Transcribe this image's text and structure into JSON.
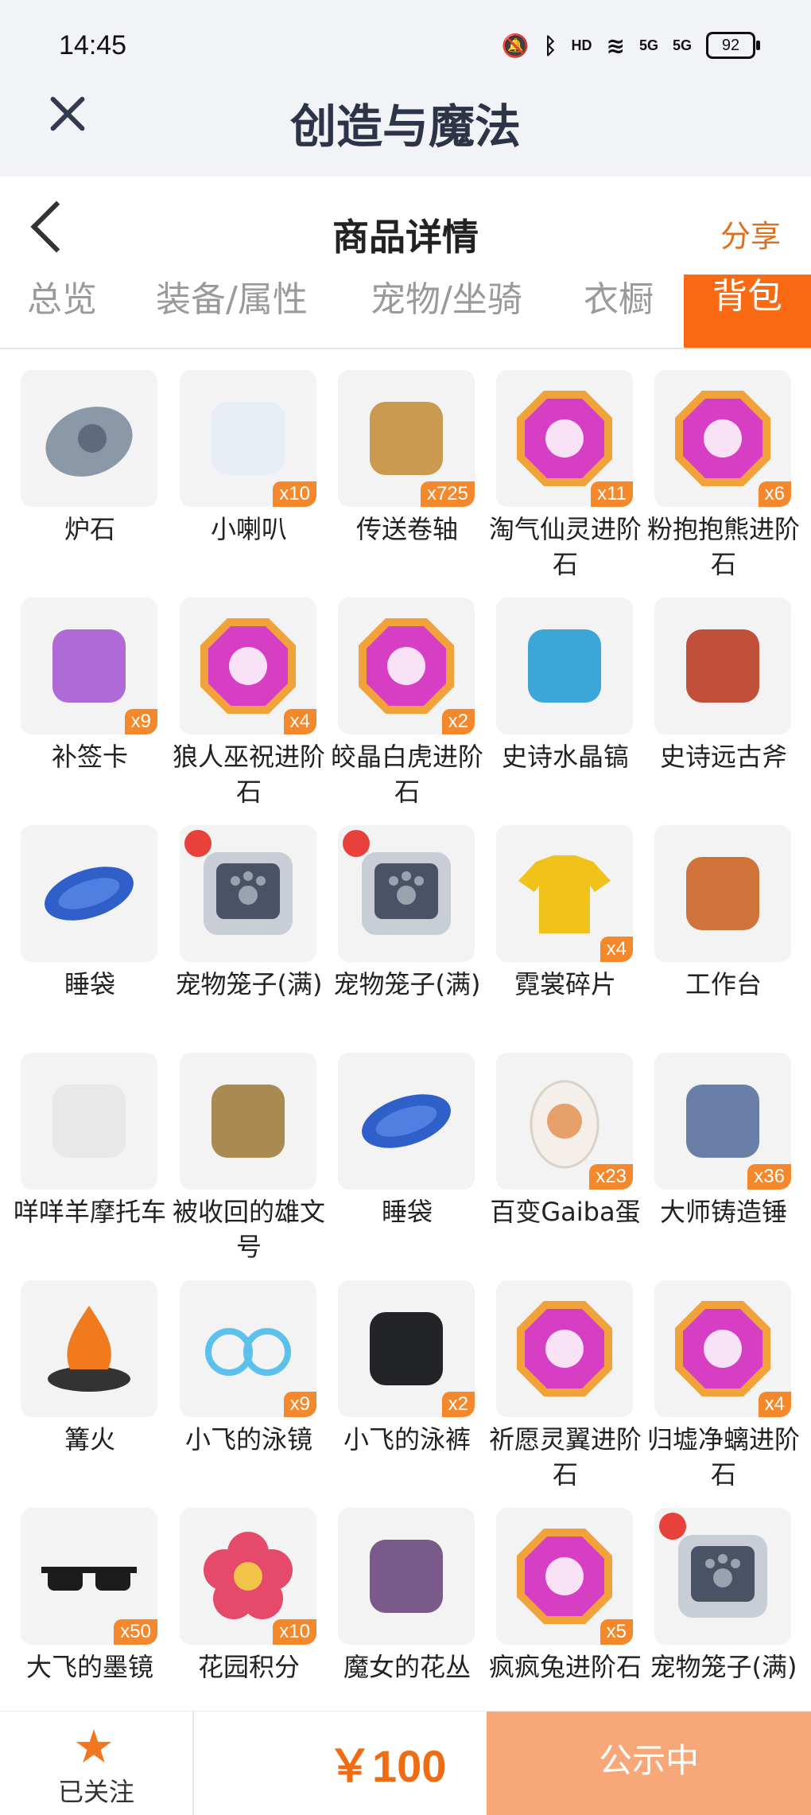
{
  "status_bar": {
    "time": "14:45",
    "icons": [
      "mute-icon",
      "bluetooth-icon",
      "hd-icon",
      "wifi-icon",
      "signal-5g-icon",
      "signal-5g-icon",
      "battery-icon"
    ],
    "hd_text": "HD",
    "net1": "5G",
    "net2": "5G",
    "battery": "92"
  },
  "app": {
    "title": "创造与魔法"
  },
  "header": {
    "title": "商品详情",
    "share_label": "分享"
  },
  "tabs": [
    {
      "label": "总览"
    },
    {
      "label": "装备/属性"
    },
    {
      "label": "宠物/坐骑"
    },
    {
      "label": "衣橱"
    },
    {
      "label": "背包"
    }
  ],
  "active_tab": "背包",
  "items": [
    {
      "name": "炉石",
      "count": "",
      "icon": "stone-icon",
      "color": "#8a98a8"
    },
    {
      "name": "小喇叭",
      "count": "x10",
      "icon": "megaphone-icon",
      "color": "#e8eef4"
    },
    {
      "name": "传送卷轴",
      "count": "x725",
      "icon": "scroll-icon",
      "color": "#c99a4f"
    },
    {
      "name": "淘气仙灵进阶石",
      "count": "x11",
      "icon": "gem-icon",
      "color": "#d63ec4"
    },
    {
      "name": "粉抱抱熊进阶石",
      "count": "x6",
      "icon": "gem-icon",
      "color": "#d63ec4"
    },
    {
      "name": "补签卡",
      "count": "x9",
      "icon": "ticket-icon",
      "color": "#b06ad8"
    },
    {
      "name": "狼人巫祝进阶石",
      "count": "x4",
      "icon": "gem-icon",
      "color": "#d63ec4"
    },
    {
      "name": "皎晶白虎进阶石",
      "count": "x2",
      "icon": "gem-icon",
      "color": "#d63ec4"
    },
    {
      "name": "史诗水晶镐",
      "count": "",
      "icon": "pickaxe-icon",
      "color": "#3aa7d8"
    },
    {
      "name": "史诗远古斧",
      "count": "",
      "icon": "axe-icon",
      "color": "#c0503a"
    },
    {
      "name": "睡袋",
      "count": "",
      "icon": "sleeping-bag-icon",
      "color": "#2f5fc8"
    },
    {
      "name": "宠物笼子(满)",
      "count": "",
      "icon": "pet-cage-icon",
      "color": "#4a5266"
    },
    {
      "name": "宠物笼子(满)",
      "count": "",
      "icon": "pet-cage-icon",
      "color": "#4a5266"
    },
    {
      "name": "霓裳碎片",
      "count": "x4",
      "icon": "shirt-icon",
      "color": "#f0c21a"
    },
    {
      "name": "工作台",
      "count": "",
      "icon": "workbench-icon",
      "color": "#d0733a"
    },
    {
      "name": "咩咩羊摩托车",
      "count": "",
      "icon": "scooter-icon",
      "color": "#e8e8e8"
    },
    {
      "name": "被收回的雄文号",
      "count": "",
      "icon": "wreck-icon",
      "color": "#a88a52"
    },
    {
      "name": "睡袋",
      "count": "",
      "icon": "sleeping-bag-icon",
      "color": "#2f5fc8"
    },
    {
      "name": "百变Gaiba蛋",
      "count": "x23",
      "icon": "egg-icon",
      "color": "#f4efe8"
    },
    {
      "name": "大师铸造锤",
      "count": "x36",
      "icon": "hammer-icon",
      "color": "#6a7fa8"
    },
    {
      "name": "篝火",
      "count": "",
      "icon": "campfire-icon",
      "color": "#f07a1c"
    },
    {
      "name": "小飞的泳镜",
      "count": "x9",
      "icon": "goggles-icon",
      "color": "#5cc2ec"
    },
    {
      "name": "小飞的泳裤",
      "count": "x2",
      "icon": "swim-trunks-icon",
      "color": "#222428"
    },
    {
      "name": "祈愿灵翼进阶石",
      "count": "",
      "icon": "gem-icon",
      "color": "#d63ec4"
    },
    {
      "name": "归墟净螭进阶石",
      "count": "x4",
      "icon": "gem-icon",
      "color": "#d63ec4"
    },
    {
      "name": "大飞的墨镜",
      "count": "x50",
      "icon": "sunglasses-icon",
      "color": "#1c1c1c"
    },
    {
      "name": "花园积分",
      "count": "x10",
      "icon": "flower-icon",
      "color": "#e64a6a"
    },
    {
      "name": "魔女的花丛",
      "count": "",
      "icon": "flower-bush-icon",
      "color": "#7a5a8a"
    },
    {
      "name": "疯疯兔进阶石",
      "count": "x5",
      "icon": "gem-icon",
      "color": "#d63ec4"
    },
    {
      "name": "宠物笼子(满)",
      "count": "",
      "icon": "pet-cage-icon",
      "color": "#4a5266"
    }
  ],
  "bottom_bar": {
    "follow_label": "已关注",
    "price": "￥100",
    "status_label": "公示中"
  },
  "colors": {
    "accent": "#f96a12",
    "badge": "#f4882d",
    "status_button": "#f8a878",
    "price": "#f06b12"
  }
}
